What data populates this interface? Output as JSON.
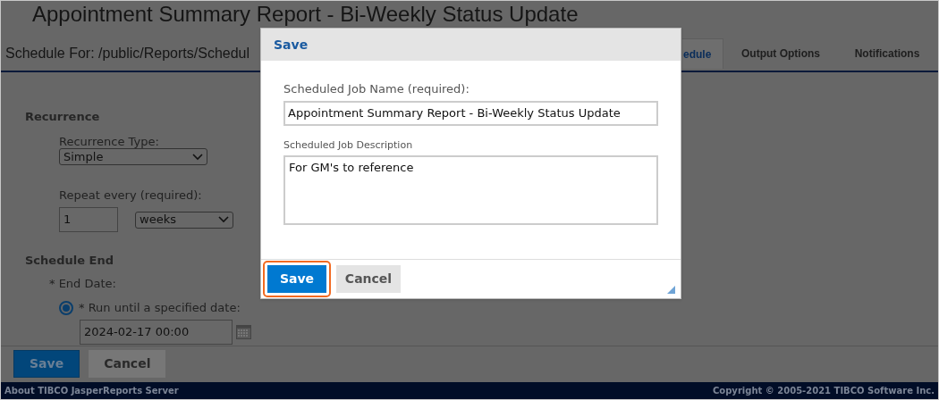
{
  "page": {
    "title": "Appointment Summary Report - Bi-Weekly Status Update",
    "schedule_for": "Schedule For: /public/Reports/Schedul",
    "tabs": [
      {
        "label": "edule",
        "selected": true
      },
      {
        "label": "Output Options",
        "selected": false
      },
      {
        "label": "Notifications",
        "selected": false
      }
    ],
    "recurrence": {
      "heading": "Recurrence",
      "type_label": "Recurrence Type:",
      "type_value": "Simple",
      "repeat_label": "Repeat every (required):",
      "repeat_value": "1",
      "repeat_unit": "weeks"
    },
    "schedule_end": {
      "heading": "Schedule End",
      "end_date_label": "* End Date:",
      "option": {
        "label": "* Run until a specified date:",
        "selected": true
      },
      "date_value": "2024-02-17 00:00"
    },
    "buttons": [
      {
        "label": "Save",
        "kind": "primary"
      },
      {
        "label": "Cancel",
        "kind": "secondary"
      }
    ]
  },
  "dialog": {
    "title": "Save",
    "name_label": "Scheduled Job Name (required):",
    "name_value": "Appointment Summary Report - Bi-Weekly Status Update",
    "description_label": "Scheduled Job Description",
    "description_value": "For GM's to reference",
    "buttons": [
      {
        "label": "Save",
        "kind": "primary",
        "highlighted": true
      },
      {
        "label": "Cancel",
        "kind": "secondary",
        "highlighted": false
      }
    ]
  },
  "footer": {
    "left": "About TIBCO JasperReports Server",
    "right": "Copyright © 2005-2021 TIBCO Software Inc."
  }
}
